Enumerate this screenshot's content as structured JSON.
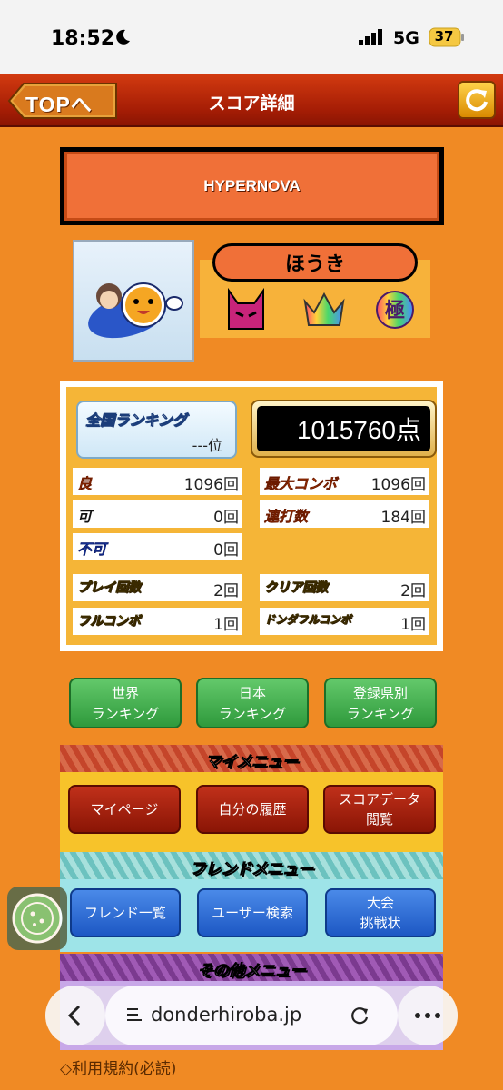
{
  "status": {
    "time": "18:52",
    "network": "5G",
    "battery": "37"
  },
  "header": {
    "back_label": "TOPへ",
    "title": "スコア詳細"
  },
  "song": {
    "title": "HYPERNOVA"
  },
  "player": {
    "name": "ほうき"
  },
  "ranking": {
    "label": "全国ランキング",
    "value": "---位"
  },
  "score": {
    "value": "1015760点"
  },
  "stats": {
    "ryo_label": "良",
    "ryo_value": "1096回",
    "ka_label": "可",
    "ka_value": "0回",
    "fuka_label": "不可",
    "fuka_value": "0回",
    "maxcombo_label": "最大コンボ",
    "maxcombo_value": "1096回",
    "renda_label": "連打数",
    "renda_value": "184回",
    "play_label": "プレイ回数",
    "play_value": "2回",
    "clear_label": "クリア回数",
    "clear_value": "2回",
    "fullcombo_label": "フルコンボ",
    "fullcombo_value": "1回",
    "donderful_label": "ドンダフルコンボ",
    "donderful_value": "1回"
  },
  "rank_buttons": [
    {
      "line1": "世界",
      "line2": "ランキング"
    },
    {
      "line1": "日本",
      "line2": "ランキング"
    },
    {
      "line1": "登録県別",
      "line2": "ランキング"
    }
  ],
  "my_menu": {
    "title": "マイメニュー",
    "items": [
      {
        "line1": "マイページ",
        "line2": ""
      },
      {
        "line1": "自分の履歴",
        "line2": ""
      },
      {
        "line1": "スコアデータ",
        "line2": "閲覧"
      }
    ]
  },
  "friend_menu": {
    "title": "フレンドメニュー",
    "items": [
      {
        "line1": "フレンド一覧",
        "line2": ""
      },
      {
        "line1": "ユーザー検索",
        "line2": ""
      },
      {
        "line1": "大会",
        "line2": "挑戦状"
      }
    ]
  },
  "other_menu": {
    "title": "その他メニュー"
  },
  "footer": {
    "terms": "◇利用規約(必読)"
  },
  "browser": {
    "url": "donderhiroba.jp"
  }
}
